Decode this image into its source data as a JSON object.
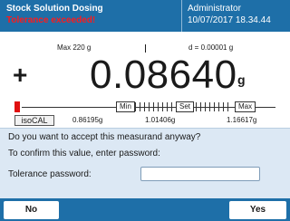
{
  "header": {
    "title": "Stock Solution Dosing",
    "alert": "Tolerance exceeded!",
    "user": "Administrator",
    "datetime": "10/07/2017 18.34.44"
  },
  "info": {
    "max": "Max 220 g",
    "d": "d = 0.00001 g"
  },
  "weight": {
    "sign": "+",
    "value": "0.08640",
    "unit": "g"
  },
  "tolerance": {
    "min_tag": "Min",
    "set_tag": "Set",
    "max_tag": "Max",
    "isocal": "isoCAL",
    "min_value": "0.86195g",
    "set_value": "1.01406g",
    "max_value": "1.16617g"
  },
  "dialog": {
    "question": "Do you want to accept this measurand anyway?",
    "instruction": "To confirm this value, enter password:",
    "password_label": "Tolerance password:",
    "password_value": ""
  },
  "buttons": {
    "no": "No",
    "yes": "Yes"
  },
  "colors": {
    "header_bg": "#1e6fa8",
    "alert": "#ff1a1a",
    "panel_bg": "#dce8f4",
    "indicator": "#e01010"
  }
}
